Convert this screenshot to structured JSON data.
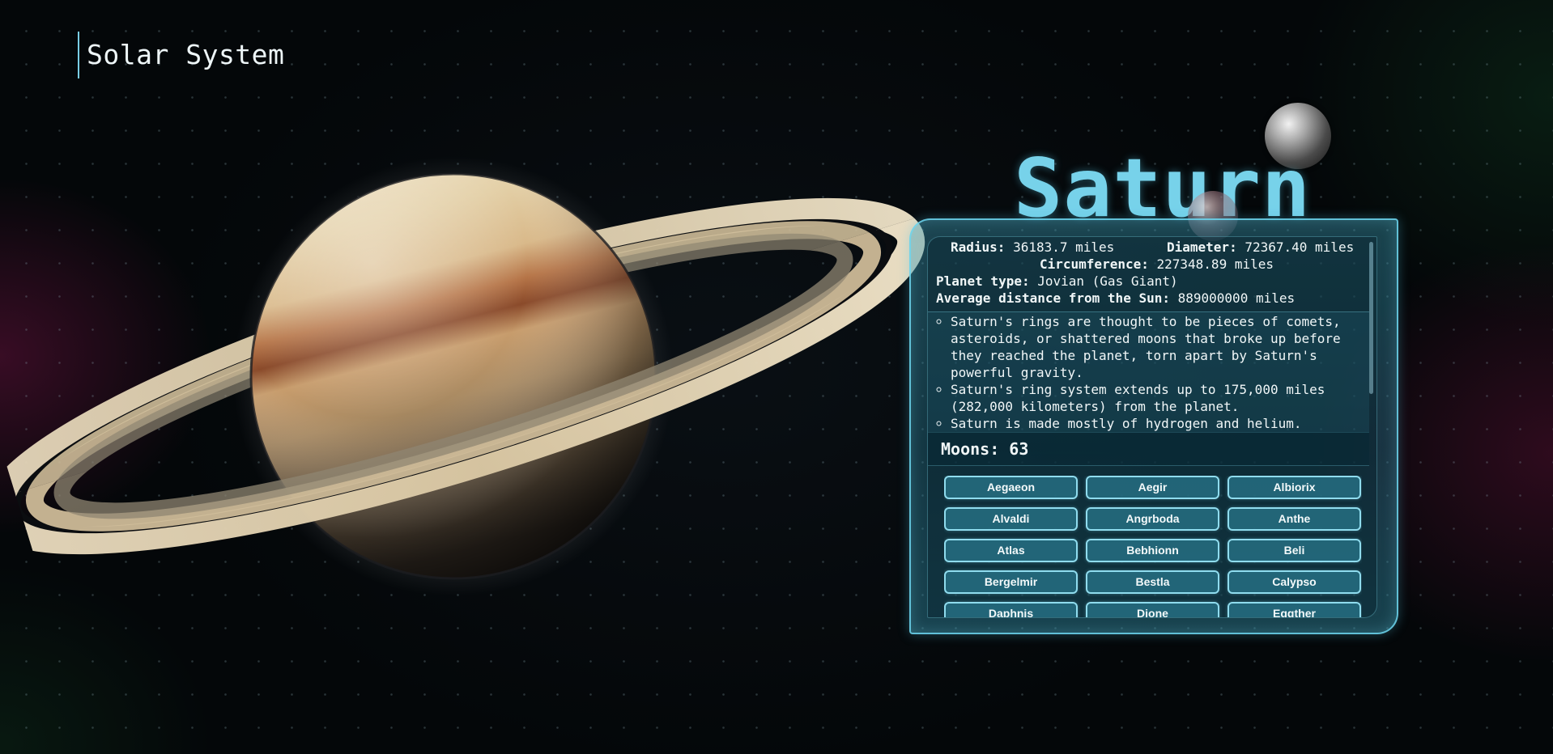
{
  "app": {
    "title": "Solar System"
  },
  "planet": {
    "name": "Saturn",
    "stats": {
      "radius_label": "Radius:",
      "radius_value": "36183.7 miles",
      "diameter_label": "Diameter:",
      "diameter_value": "72367.40 miles",
      "circumference_label": "Circumference:",
      "circumference_value": "227348.89 miles",
      "type_label": "Planet type:",
      "type_value": "Jovian (Gas Giant)",
      "distance_label": "Average distance from the Sun:",
      "distance_value": "889000000 miles"
    },
    "facts": [
      "Saturn's rings are thought to be pieces of comets, asteroids, or shattered moons that broke up before they reached the planet, torn apart by Saturn's powerful gravity.",
      "Saturn's ring system extends up to 175,000 miles (282,000 kilometers) from the planet.",
      "Saturn is made mostly of hydrogen and helium."
    ],
    "moons_header": "Moons: 63",
    "moons": [
      "Aegaeon",
      "Aegir",
      "Albiorix",
      "Alvaldi",
      "Angrboda",
      "Anthe",
      "Atlas",
      "Bebhionn",
      "Beli",
      "Bergelmir",
      "Bestla",
      "Calypso",
      "Daphnis",
      "Dione",
      "Eggther"
    ]
  },
  "colors": {
    "accent": "#77d2ea",
    "panel_border": "#8fdcee",
    "text": "#f1f7f8"
  },
  "icons": {
    "planet_image": "saturn-planet-illustration",
    "moon_image": "moon-sphere"
  }
}
